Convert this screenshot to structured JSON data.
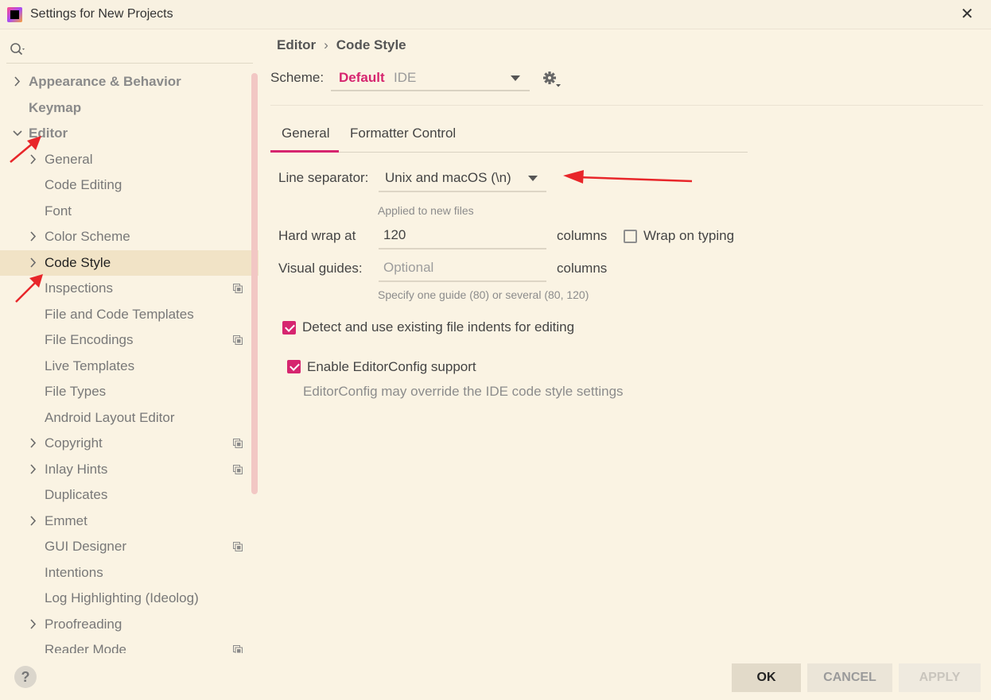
{
  "window": {
    "title": "Settings for New Projects",
    "close_label": "✕"
  },
  "colors": {
    "accent": "#d6256f",
    "background": "#faf3e3",
    "selected_row": "#f1e3c6",
    "annotation_arrow": "#e8262a"
  },
  "sidebar": {
    "search_placeholder": "",
    "items": [
      {
        "label": "Appearance & Behavior",
        "chevron": "right",
        "level": 0
      },
      {
        "label": "Keymap",
        "chevron": "",
        "level": 0
      },
      {
        "label": "Editor",
        "chevron": "down",
        "level": 0
      },
      {
        "label": "General",
        "chevron": "right",
        "level": 1
      },
      {
        "label": "Code Editing",
        "chevron": "",
        "level": 1
      },
      {
        "label": "Font",
        "chevron": "",
        "level": 1
      },
      {
        "label": "Color Scheme",
        "chevron": "right",
        "level": 1
      },
      {
        "label": "Code Style",
        "chevron": "right",
        "level": 1,
        "selected": true
      },
      {
        "label": "Inspections",
        "chevron": "",
        "level": 1,
        "project_icon": true
      },
      {
        "label": "File and Code Templates",
        "chevron": "",
        "level": 1
      },
      {
        "label": "File Encodings",
        "chevron": "",
        "level": 1,
        "project_icon": true
      },
      {
        "label": "Live Templates",
        "chevron": "",
        "level": 1
      },
      {
        "label": "File Types",
        "chevron": "",
        "level": 1
      },
      {
        "label": "Android Layout Editor",
        "chevron": "",
        "level": 1
      },
      {
        "label": "Copyright",
        "chevron": "right",
        "level": 1,
        "project_icon": true
      },
      {
        "label": "Inlay Hints",
        "chevron": "right",
        "level": 1,
        "project_icon": true
      },
      {
        "label": "Duplicates",
        "chevron": "",
        "level": 1
      },
      {
        "label": "Emmet",
        "chevron": "right",
        "level": 1
      },
      {
        "label": "GUI Designer",
        "chevron": "",
        "level": 1,
        "project_icon": true
      },
      {
        "label": "Intentions",
        "chevron": "",
        "level": 1
      },
      {
        "label": "Log Highlighting (Ideolog)",
        "chevron": "",
        "level": 1
      },
      {
        "label": "Proofreading",
        "chevron": "right",
        "level": 1
      },
      {
        "label": "Reader Mode",
        "chevron": "",
        "level": 1,
        "project_icon": true
      }
    ]
  },
  "breadcrumb": {
    "parent": "Editor",
    "separator": "›",
    "current": "Code Style"
  },
  "scheme": {
    "label": "Scheme:",
    "name": "Default",
    "sub": "IDE"
  },
  "tabs": [
    {
      "label": "General",
      "active": true
    },
    {
      "label": "Formatter Control",
      "active": false
    }
  ],
  "form": {
    "line_separator_label": "Line separator:",
    "line_separator_value": "Unix and macOS (\\n)",
    "line_separator_hint": "Applied to new files",
    "hard_wrap_label": "Hard wrap at",
    "hard_wrap_value": "120",
    "hard_wrap_unit": "columns",
    "wrap_on_typing_label": "Wrap on typing",
    "wrap_on_typing_checked": false,
    "visual_guides_label": "Visual guides:",
    "visual_guides_placeholder": "Optional",
    "visual_guides_unit": "columns",
    "visual_guides_hint": "Specify one guide (80) or several (80, 120)",
    "detect_indents_label": "Detect and use existing file indents for editing",
    "detect_indents_checked": true,
    "editorconfig_label": "Enable EditorConfig support",
    "editorconfig_checked": true,
    "editorconfig_hint": "EditorConfig may override the IDE code style settings"
  },
  "footer": {
    "help_label": "?",
    "ok_label": "OK",
    "cancel_label": "CANCEL",
    "apply_label": "APPLY"
  }
}
